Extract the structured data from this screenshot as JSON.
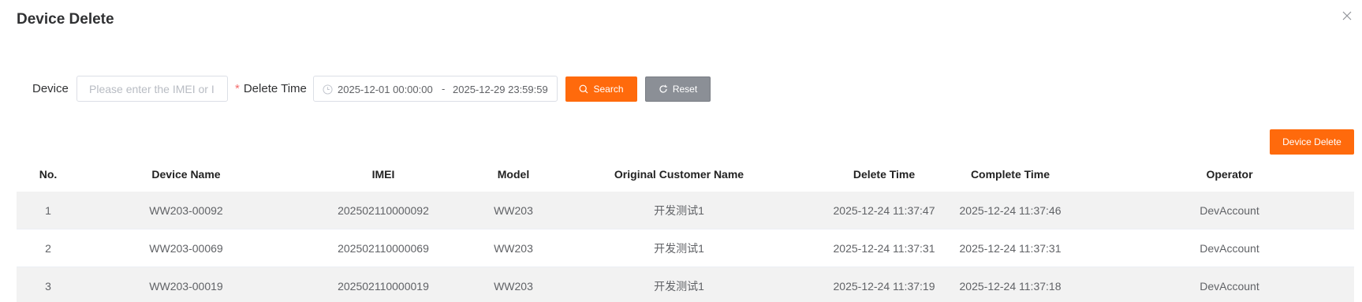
{
  "dialog": {
    "title": "Device Delete",
    "close_icon": "close-icon"
  },
  "filters": {
    "device_label": "Device",
    "device_placeholder": "Please enter the IMEI or I",
    "device_value": "",
    "delete_time_label": "Delete Time",
    "date_start": "2025-12-01 00:00:00",
    "date_separator": "-",
    "date_end": "2025-12-29 23:59:59",
    "search_label": "Search",
    "reset_label": "Reset"
  },
  "toolbar": {
    "device_delete_label": "Device Delete"
  },
  "colors": {
    "accent": "#ff6a0c",
    "reset": "#8b8f96",
    "required": "#f56c6c",
    "stripe": "#f2f2f2"
  },
  "table": {
    "columns": [
      "No.",
      "Device Name",
      "IMEI",
      "Model",
      "Original Customer Name",
      "Delete Time",
      "Complete Time",
      "Operator"
    ],
    "rows": [
      [
        "1",
        "WW203-00092",
        "202502110000092",
        "WW203",
        "开发测试1",
        "2025-12-24 11:37:47",
        "2025-12-24 11:37:46",
        "DevAccount"
      ],
      [
        "2",
        "WW203-00069",
        "202502110000069",
        "WW203",
        "开发测试1",
        "2025-12-24 11:37:31",
        "2025-12-24 11:37:31",
        "DevAccount"
      ],
      [
        "3",
        "WW203-00019",
        "202502110000019",
        "WW203",
        "开发测试1",
        "2025-12-24 11:37:19",
        "2025-12-24 11:37:18",
        "DevAccount"
      ]
    ]
  }
}
